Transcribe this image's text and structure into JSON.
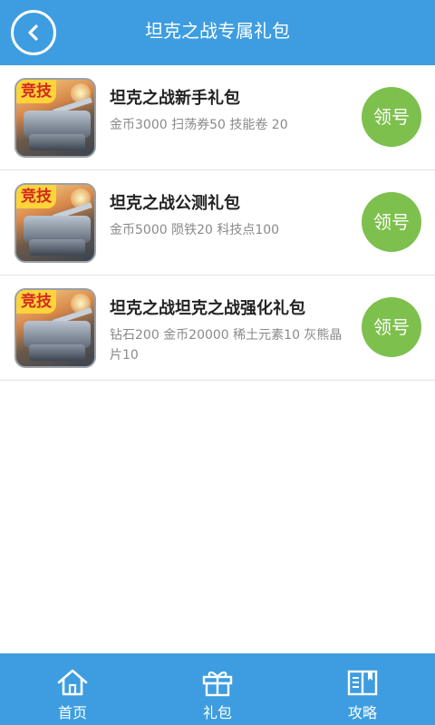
{
  "header": {
    "title": "坦克之战专属礼包",
    "back_icon": "chevron-left-icon"
  },
  "gifts": [
    {
      "name": "坦克之战新手礼包",
      "desc": "金币3000 扫荡券50 技能卷 20",
      "button": "领号",
      "thumb_badge": "竞技"
    },
    {
      "name": "坦克之战公测礼包",
      "desc": "金币5000 陨铁20 科技点100",
      "button": "领号",
      "thumb_badge": "竞技"
    },
    {
      "name": "坦克之战坦克之战强化礼包",
      "desc": "钻石200 金币20000 稀土元素10 灰熊晶片10",
      "button": "领号",
      "thumb_badge": "竞技"
    }
  ],
  "nav": [
    {
      "label": "首页",
      "icon": "home-icon"
    },
    {
      "label": "礼包",
      "icon": "gift-icon"
    },
    {
      "label": "攻略",
      "icon": "book-icon"
    }
  ],
  "colors": {
    "primary": "#3d9de0",
    "button_green": "#7dc04d",
    "title_text": "#222222",
    "desc_text": "#8a8a8a"
  }
}
